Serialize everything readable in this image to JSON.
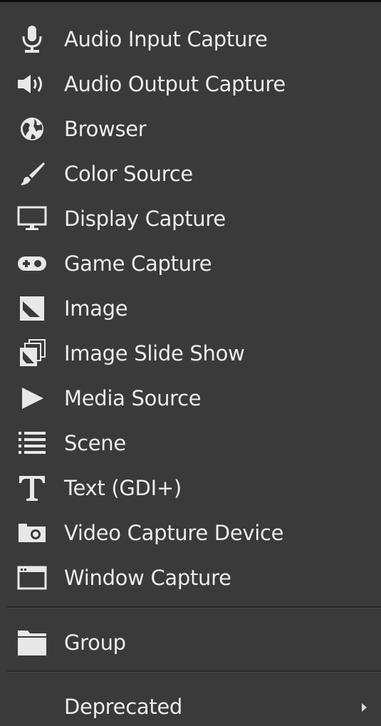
{
  "menu": {
    "items": [
      {
        "label": "Audio Input Capture",
        "icon": "microphone-icon"
      },
      {
        "label": "Audio Output Capture",
        "icon": "speaker-icon"
      },
      {
        "label": "Browser",
        "icon": "globe-icon"
      },
      {
        "label": "Color Source",
        "icon": "paintbrush-icon"
      },
      {
        "label": "Display Capture",
        "icon": "monitor-icon"
      },
      {
        "label": "Game Capture",
        "icon": "gamepad-icon"
      },
      {
        "label": "Image",
        "icon": "image-icon"
      },
      {
        "label": "Image Slide Show",
        "icon": "image-stack-icon"
      },
      {
        "label": "Media Source",
        "icon": "play-icon"
      },
      {
        "label": "Scene",
        "icon": "list-icon"
      },
      {
        "label": "Text (GDI+)",
        "icon": "text-icon"
      },
      {
        "label": "Video Capture Device",
        "icon": "camera-icon"
      },
      {
        "label": "Window Capture",
        "icon": "window-icon"
      }
    ],
    "group": {
      "label": "Group",
      "icon": "folder-icon"
    },
    "deprecated": {
      "label": "Deprecated",
      "icon": "submenu-arrow-icon"
    }
  },
  "colors": {
    "background": "#3a3a3a",
    "text": "#ececec",
    "icon": "#e8e8e8",
    "separator": "#262626"
  }
}
